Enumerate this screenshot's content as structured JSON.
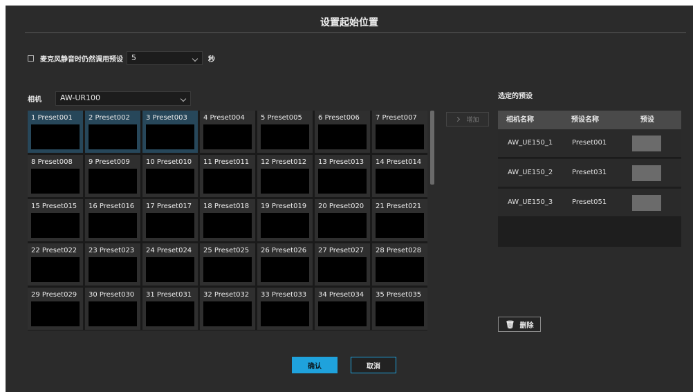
{
  "dialog": {
    "title": "设置起始位置"
  },
  "mute": {
    "label": "麦克风静音时仍然调用预设",
    "value": "5",
    "unit": "秒"
  },
  "camera": {
    "label": "相机",
    "value": "AW-UR100"
  },
  "presets": [
    "1 Preset001",
    "2 Preset002",
    "3 Preset003",
    "4 Preset004",
    "5 Preset005",
    "6 Preset006",
    "7 Preset007",
    "8 Preset008",
    "9 Preset009",
    "10 Preset010",
    "11 Preset011",
    "12 Preset012",
    "13 Preset013",
    "14 Preset014",
    "15 Preset015",
    "16 Preset016",
    "17 Preset017",
    "18 Preset018",
    "19 Preset019",
    "20 Preset020",
    "21 Preset021",
    "22 Preset022",
    "23 Preset023",
    "24 Preset024",
    "25 Preset025",
    "26 Preset026",
    "27 Preset027",
    "28 Preset028",
    "29 Preset029",
    "30 Preset030",
    "31 Preset031",
    "32 Preset032",
    "33 Preset033",
    "34 Preset034",
    "35 Preset035"
  ],
  "add_button": {
    "label": "增加"
  },
  "selected": {
    "title": "选定的预设",
    "headers": {
      "camera": "相机名称",
      "preset_name": "预设名称",
      "preset": "预设"
    },
    "rows": [
      {
        "camera": "AW_UE150_1",
        "preset": "Preset001"
      },
      {
        "camera": "AW_UE150_2",
        "preset": "Preset031"
      },
      {
        "camera": "AW_UE150_3",
        "preset": "Preset051"
      }
    ]
  },
  "delete_button": {
    "label": "删除"
  },
  "footer": {
    "ok": "确认",
    "cancel": "取消"
  },
  "colors": {
    "accent": "#1fa2dc",
    "selected_cell": "#27475a",
    "background": "#2b2b2b"
  }
}
